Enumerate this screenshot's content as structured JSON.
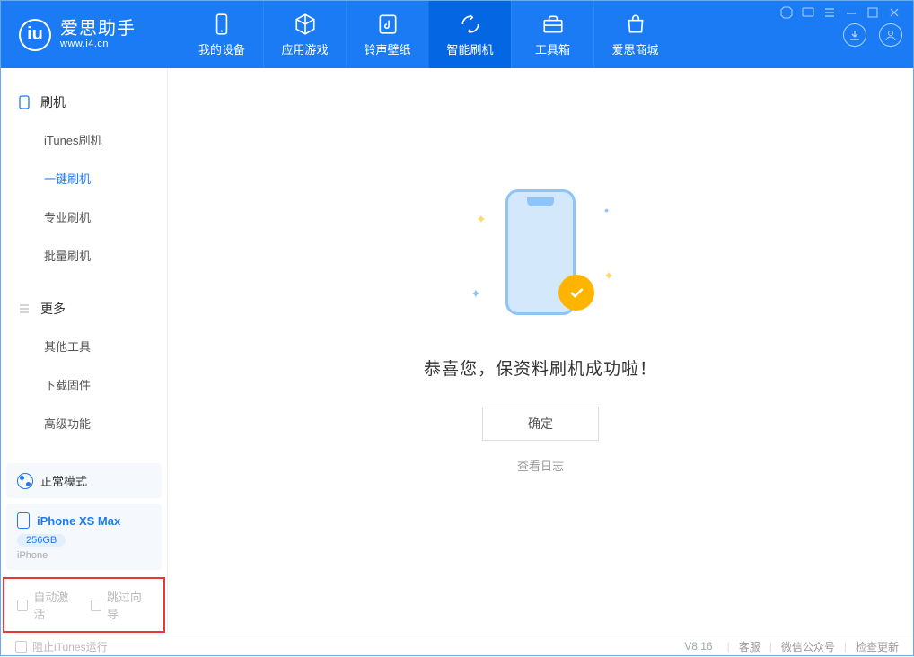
{
  "app": {
    "name": "爱思助手",
    "url": "www.i4.cn"
  },
  "nav": {
    "my_device": "我的设备",
    "apps_games": "应用游戏",
    "ringtones": "铃声壁纸",
    "smart_flash": "智能刷机",
    "toolbox": "工具箱",
    "store": "爱思商城"
  },
  "sidebar": {
    "flash_title": "刷机",
    "items": {
      "itunes": "iTunes刷机",
      "onekey": "一键刷机",
      "pro": "专业刷机",
      "batch": "批量刷机"
    },
    "more_title": "更多",
    "more_items": {
      "other_tools": "其他工具",
      "download_fw": "下载固件",
      "advanced": "高级功能"
    },
    "status_mode": "正常模式",
    "device": {
      "name": "iPhone XS Max",
      "storage": "256GB",
      "type": "iPhone"
    },
    "checks": {
      "auto_activate": "自动激活",
      "skip_guide": "跳过向导"
    }
  },
  "main": {
    "success_text": "恭喜您，保资料刷机成功啦！",
    "ok_button": "确定",
    "view_log": "查看日志"
  },
  "footer": {
    "block_itunes": "阻止iTunes运行",
    "version": "V8.16",
    "support": "客服",
    "wechat": "微信公众号",
    "check_update": "检查更新"
  }
}
